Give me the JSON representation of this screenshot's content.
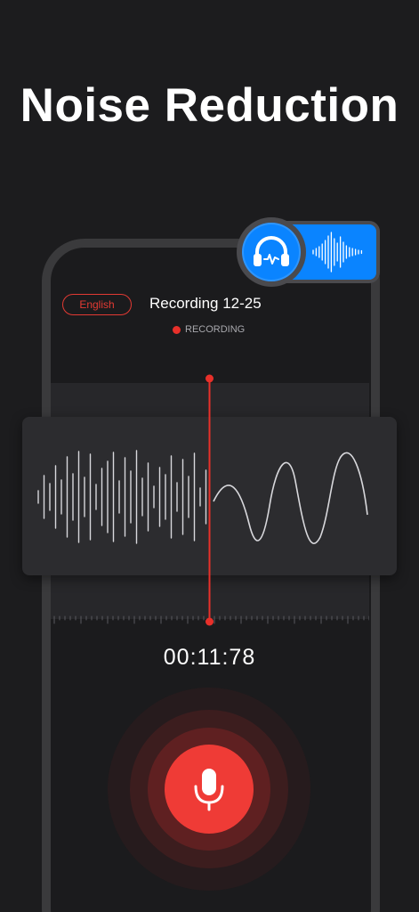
{
  "headline": "Noise Reduction",
  "recorder": {
    "language": "English",
    "title": "Recording 12-25",
    "status": "RECORDING",
    "timer": "00:11:78"
  },
  "badge": {
    "icon": "headphones-icon",
    "wave_icon": "audio-wave-icon"
  },
  "colors": {
    "background": "#1c1c1e",
    "accent_red": "#ef3b36",
    "badge_blue": "#0a84ff",
    "waveform": "#d8d8dc"
  }
}
